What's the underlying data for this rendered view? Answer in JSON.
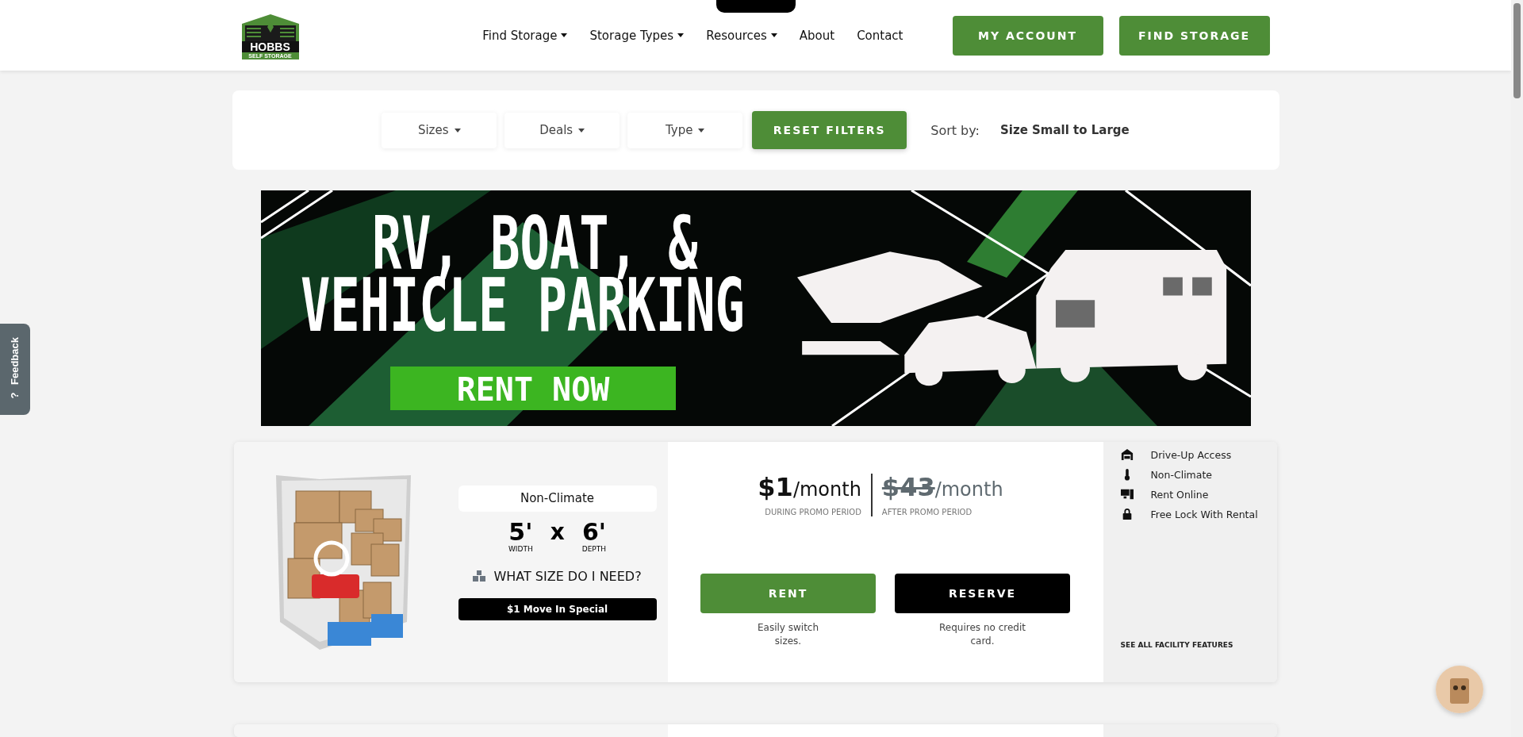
{
  "header": {
    "logo": {
      "name": "HOBBS",
      "tagline": "SELF STORAGE"
    },
    "nav": [
      {
        "label": "Find Storage",
        "dropdown": true
      },
      {
        "label": "Storage Types",
        "dropdown": true
      },
      {
        "label": "Resources",
        "dropdown": true
      },
      {
        "label": "About",
        "dropdown": false
      },
      {
        "label": "Contact",
        "dropdown": false
      }
    ],
    "buttons": [
      "MY ACCOUNT",
      "FIND STORAGE"
    ]
  },
  "filters": {
    "dropdowns": [
      "Sizes",
      "Deals",
      "Type"
    ],
    "reset": "RESET FILTERS",
    "sort_label": "Sort by:",
    "sort_value": "Size Small to Large"
  },
  "banner": {
    "lines": [
      "RV, BOAT, &",
      "VEHICLE PARKING"
    ],
    "button": "RENT NOW"
  },
  "units": [
    {
      "climate": "Non-Climate",
      "width": "5'",
      "depth": "6'",
      "x": "x",
      "width_label": "WIDTH",
      "depth_label": "DEPTH",
      "size_help": "WHAT SIZE DO I NEED?",
      "special": "$1 Move In Special",
      "prices": [
        {
          "amount": "$1",
          "unit": "/month",
          "caption": "DURING PROMO PERIOD",
          "struck": false
        },
        {
          "amount": "$43",
          "unit": "/month",
          "caption": "AFTER PROMO PERIOD",
          "struck": true
        }
      ],
      "actions": [
        {
          "kind": "rent",
          "label": "RENT",
          "note": "Easily switch sizes."
        },
        {
          "kind": "reserve",
          "label": "RESERVE",
          "note": "Requires no credit card."
        }
      ],
      "features": [
        {
          "kind": "drive-up",
          "label": "Drive-Up Access"
        },
        {
          "kind": "thermometer",
          "label": "Non-Climate"
        },
        {
          "kind": "computer",
          "label": "Rent Online"
        },
        {
          "kind": "lock",
          "label": "Free Lock With Rental"
        }
      ],
      "features_link": "SEE ALL FACILITY FEATURES"
    }
  ],
  "feedback_tab": {
    "label": "Feedback",
    "icon": "?"
  }
}
